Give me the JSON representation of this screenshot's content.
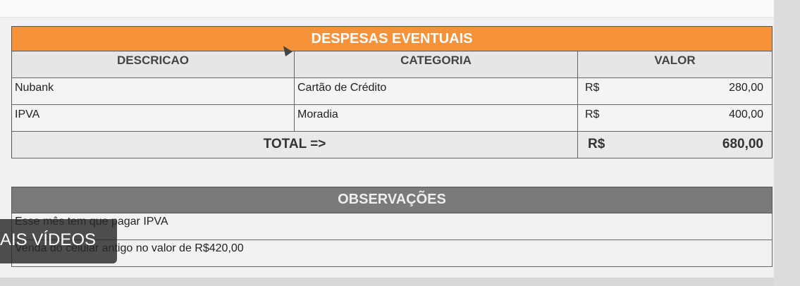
{
  "expenses_table": {
    "title": "DESPESAS EVENTUAIS",
    "columns": [
      "DESCRICAO",
      "CATEGORIA",
      "VALOR"
    ],
    "rows": [
      {
        "descricao": "Nubank",
        "categoria": "Cartão de Crédito",
        "moeda": "R$",
        "valor": "280,00"
      },
      {
        "descricao": "IPVA",
        "categoria": "Moradia",
        "moeda": "R$",
        "valor": "400,00"
      }
    ],
    "total": {
      "label": "TOTAL =>",
      "moeda": "R$",
      "valor": "680,00"
    },
    "colors": {
      "header": "#f6923a"
    }
  },
  "observations_table": {
    "title": "OBSERVAÇÕES",
    "rows": [
      "Esse mês tem que pagar IPVA",
      "Venda do celular antigo no valor de R$420,00"
    ],
    "colors": {
      "header": "#7a7a7a"
    }
  },
  "overlay": {
    "text": "AIS VÍDEOS"
  }
}
